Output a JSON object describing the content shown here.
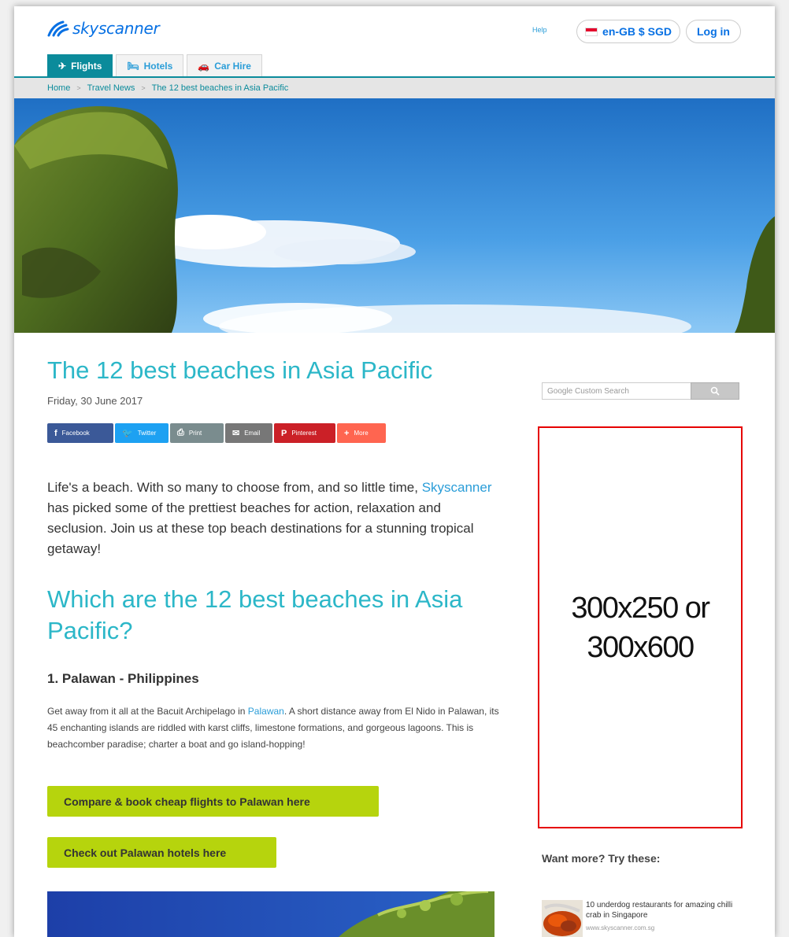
{
  "header": {
    "logo_text": "skyscanner",
    "help": "Help",
    "locale": "en-GB $ SGD",
    "login": "Log in"
  },
  "tabs": [
    {
      "label": "Flights",
      "icon": "plane-icon",
      "active": true
    },
    {
      "label": "Hotels",
      "icon": "bed-icon",
      "active": false
    },
    {
      "label": "Car Hire",
      "icon": "car-icon",
      "active": false
    }
  ],
  "breadcrumb": [
    "Home",
    "Travel News",
    "The 12 best beaches in Asia Pacific"
  ],
  "article": {
    "title": "The 12 best beaches in Asia Pacific",
    "date": "Friday, 30 June 2017",
    "share": [
      {
        "label": "Facebook",
        "icon": "f"
      },
      {
        "label": "Twitter",
        "icon": "🐦"
      },
      {
        "label": "Print",
        "icon": "⎙"
      },
      {
        "label": "Email",
        "icon": "✉"
      },
      {
        "label": "Pinterest",
        "icon": "P"
      },
      {
        "label": "More",
        "icon": "+"
      }
    ],
    "intro_1": "Life's a beach. With so many to choose from, and so little time, ",
    "intro_link": "Skyscanner",
    "intro_2": " has picked some of the prettiest beaches for action, relaxation and seclusion. Join us at these top beach destinations for a stunning tropical getaway!",
    "h2": "Which are the 12 best beaches in Asia Pacific?",
    "section_title": "1. Palawan - Philippines",
    "para_1": "Get away from it all at the Bacuit Archipelago in ",
    "para_link": "Palawan",
    "para_2": ". A short distance away from El Nido in Palawan, its 45 enchanting islands are riddled with karst cliffs, limestone formations, and gorgeous lagoons. This is beachcomber paradise; charter a boat and go island-hopping!",
    "cta_flights": "Compare & book cheap flights to Palawan here",
    "cta_hotels": "Check out Palawan hotels here"
  },
  "sidebar": {
    "search_placeholder": "Google Custom Search",
    "ad_line1": "300x250 or",
    "ad_line2": "300x600",
    "want_more": "Want more? Try these:",
    "related": {
      "title": "10 underdog restaurants for amazing chilli crab in Singapore",
      "source": "www.skyscanner.com.sg"
    }
  },
  "colors": {
    "brand_blue": "#0770e3",
    "teal": "#0b8b9b",
    "heading": "#2cb7c8",
    "cta_green": "#b6d40d",
    "ad_border": "#e60000"
  }
}
